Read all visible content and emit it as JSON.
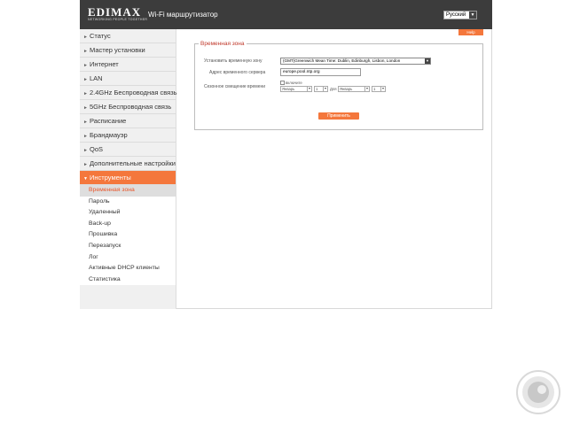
{
  "header": {
    "logo_text": "EDIMAX",
    "logo_tagline": "NETWORKING PEOPLE TOGETHER",
    "title": "Wi-Fi маршрутизатор",
    "language": "Русский"
  },
  "help_label": "Help",
  "nav": {
    "items": [
      {
        "label": "Статус"
      },
      {
        "label": "Мастер установки"
      },
      {
        "label": "Интернет"
      },
      {
        "label": "LAN"
      },
      {
        "label": "2.4GHz Беспроводная связь"
      },
      {
        "label": "5GHz Беспроводная связь"
      },
      {
        "label": "Расписание"
      },
      {
        "label": "Брандмауэр"
      },
      {
        "label": "QoS"
      },
      {
        "label": "Дополнительные настройки"
      },
      {
        "label": "Инструменты"
      }
    ],
    "sub_items": [
      {
        "label": "Временная зона"
      },
      {
        "label": "Пароль"
      },
      {
        "label": "Удаленный"
      },
      {
        "label": "Back-up"
      },
      {
        "label": "Прошивка"
      },
      {
        "label": "Перезапуск"
      },
      {
        "label": "Лог"
      },
      {
        "label": "Активные DHCP клиенты"
      },
      {
        "label": "Статистика"
      }
    ]
  },
  "form": {
    "legend": "Временная зона",
    "timezone_label": "Установить временную зону",
    "timezone_value": "(GMT)Greenwich Mean Time: Dublin, Edinburgh, Lisbon, London",
    "ntp_label": "Адрес временного сервера",
    "ntp_value": "europe.pool.ntp.org",
    "dst_label": "Сезонное смещение времени",
    "dst_checkbox_label": "включите",
    "from_month": "Январь",
    "from_day": "1",
    "to_label": "Для",
    "to_month": "Январь",
    "to_day": "1",
    "apply_label": "Применить"
  },
  "colors": {
    "accent": "#f4773c",
    "header_bg": "#3c3c3c"
  }
}
